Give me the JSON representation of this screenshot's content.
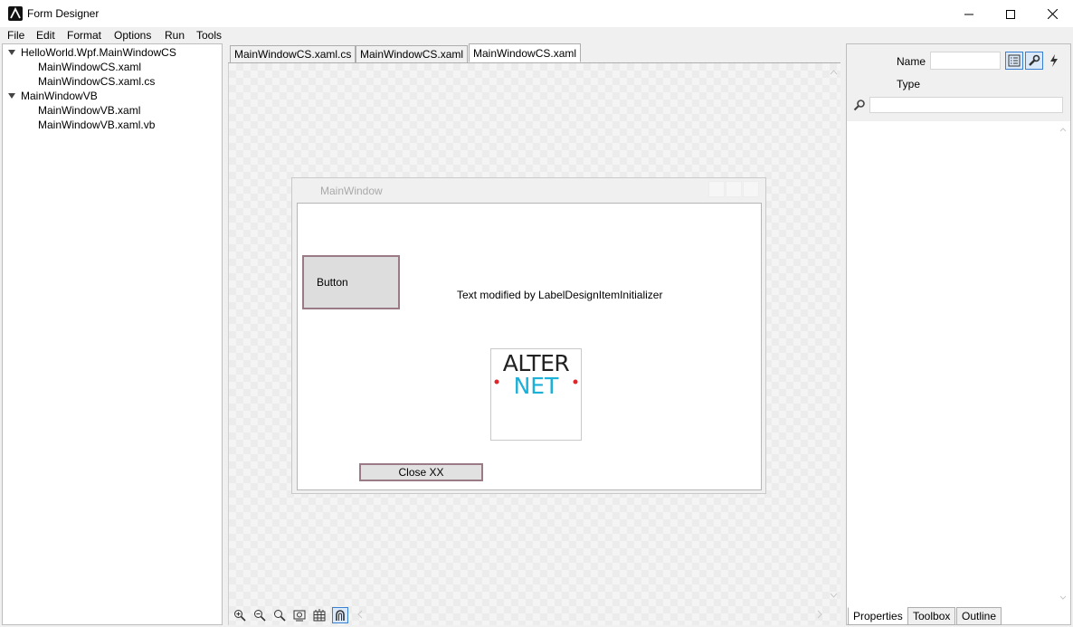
{
  "window": {
    "title": "Form Designer"
  },
  "menu": [
    "File",
    "Edit",
    "Format",
    "Options",
    "Run",
    "Tools"
  ],
  "tree": {
    "nodes": [
      {
        "label": "HelloWorld.Wpf.MainWindowCS",
        "expanded": true
      },
      {
        "label": "MainWindowCS.xaml"
      },
      {
        "label": "MainWindowCS.xaml.cs"
      },
      {
        "label": "MainWindowVB",
        "expanded": true
      },
      {
        "label": "MainWindowVB.xaml"
      },
      {
        "label": "MainWindowVB.xaml.vb"
      }
    ]
  },
  "tabs": [
    {
      "label": "MainWindowCS.xaml.cs",
      "active": false
    },
    {
      "label": "MainWindowCS.xaml",
      "active": false
    },
    {
      "label": "MainWindowCS.xaml",
      "active": true
    }
  ],
  "designer": {
    "window_title": "MainWindow",
    "button_label": "Button",
    "label_text": "Text modified by LabelDesignItemInitializer",
    "logo_top": "ALTER",
    "logo_bottom": "NET",
    "close_label": "Close XX"
  },
  "properties": {
    "name_label": "Name",
    "name_value": "",
    "type_label": "Type",
    "search_placeholder": ""
  },
  "bottom_tabs": [
    {
      "label": "Properties",
      "active": true
    },
    {
      "label": "Toolbox",
      "active": false
    },
    {
      "label": "Outline",
      "active": false
    }
  ],
  "colors": {
    "selection_border": "#9a7a86",
    "accent": "#3b7fd1",
    "logo_teal": "#1ab0d8",
    "logo_red": "#e0262a"
  },
  "icons": {
    "zoom_toolbar": [
      "zoom-in-icon",
      "zoom-out-icon",
      "zoom-reset-icon",
      "fit-to-screen-icon",
      "grid-icon",
      "snap-magnet-icon"
    ],
    "property_tools": [
      "property-list-icon",
      "wrench-icon",
      "events-lightning-icon"
    ]
  }
}
